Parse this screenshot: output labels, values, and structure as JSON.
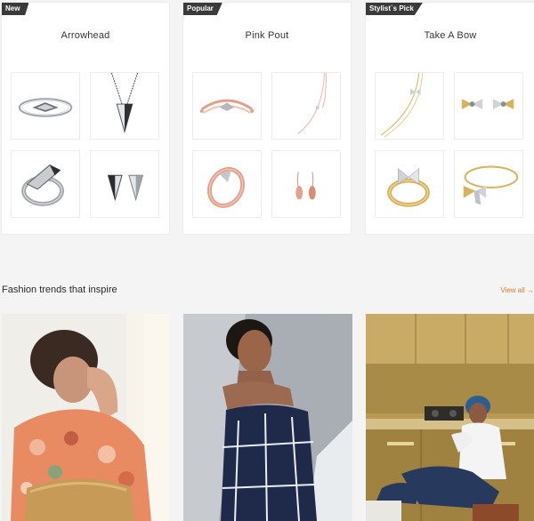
{
  "collections": [
    {
      "badge": "New",
      "title": "Arrowhead"
    },
    {
      "badge": "Popular",
      "title": "Pink Pout"
    },
    {
      "badge": "Stylist`s Pick",
      "title": "Take A Bow"
    }
  ],
  "trends": {
    "title": "Fashion trends that inspire",
    "view_all": "View all →"
  },
  "colors": {
    "accent": "#e07a2b",
    "badge": "#3a3a3a",
    "silver": "#a9adb3",
    "rose_gold": "#e3a08a",
    "gold": "#d8b25c"
  }
}
